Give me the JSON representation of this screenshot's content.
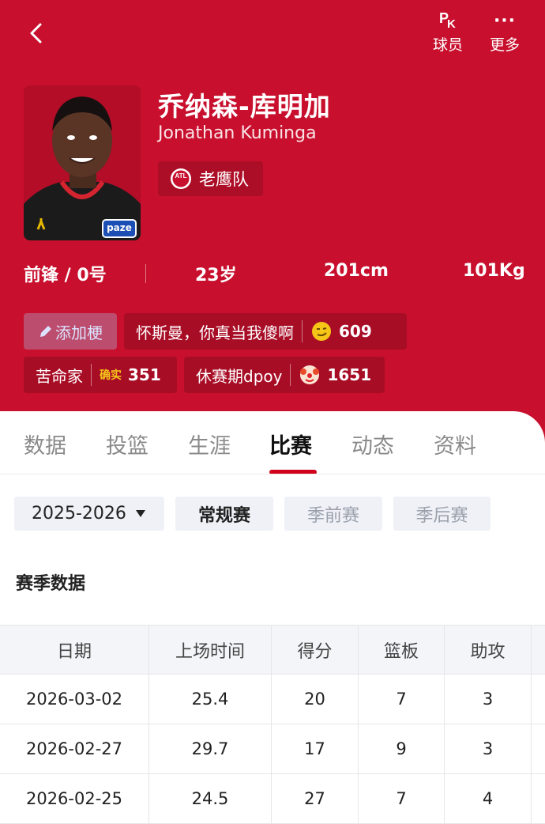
{
  "header": {
    "pk_label": "球员",
    "more_label": "更多",
    "more_icon": "···",
    "accent_color": "#c8102e"
  },
  "player": {
    "name_cn": "乔纳森-库明加",
    "name_en": "Jonathan Kuminga",
    "team": "老鹰队",
    "team_logo_text": "ATL",
    "jersey_sponsor": "paze",
    "position_number": "前锋 / 0号",
    "age": "23岁",
    "height": "201cm",
    "weight": "101Kg"
  },
  "tags": {
    "add_label": "添加梗",
    "items": [
      {
        "text": "怀斯曼，你真当我傻啊",
        "count": "609",
        "icon": "smirk-emoji-icon"
      },
      {
        "text": "苦命家",
        "badge": "确实",
        "count": "351"
      },
      {
        "text": "休赛期dpoy",
        "count": "1651",
        "icon": "clown-emoji-icon"
      }
    ]
  },
  "tabs": [
    "数据",
    "投篮",
    "生涯",
    "比赛",
    "动态",
    "资料"
  ],
  "active_tab": "比赛",
  "filters": {
    "season": "2025-2026",
    "types": [
      "常规赛",
      "季前赛",
      "季后赛"
    ],
    "active_type": "常规赛"
  },
  "section_title": "赛季数据",
  "table": {
    "headers": [
      "日期",
      "上场时间",
      "得分",
      "篮板",
      "助攻"
    ],
    "rows": [
      [
        "2026-03-02",
        "25.4",
        "20",
        "7",
        "3"
      ],
      [
        "2026-02-27",
        "29.7",
        "17",
        "9",
        "3"
      ],
      [
        "2026-02-25",
        "24.5",
        "27",
        "7",
        "4"
      ]
    ]
  }
}
